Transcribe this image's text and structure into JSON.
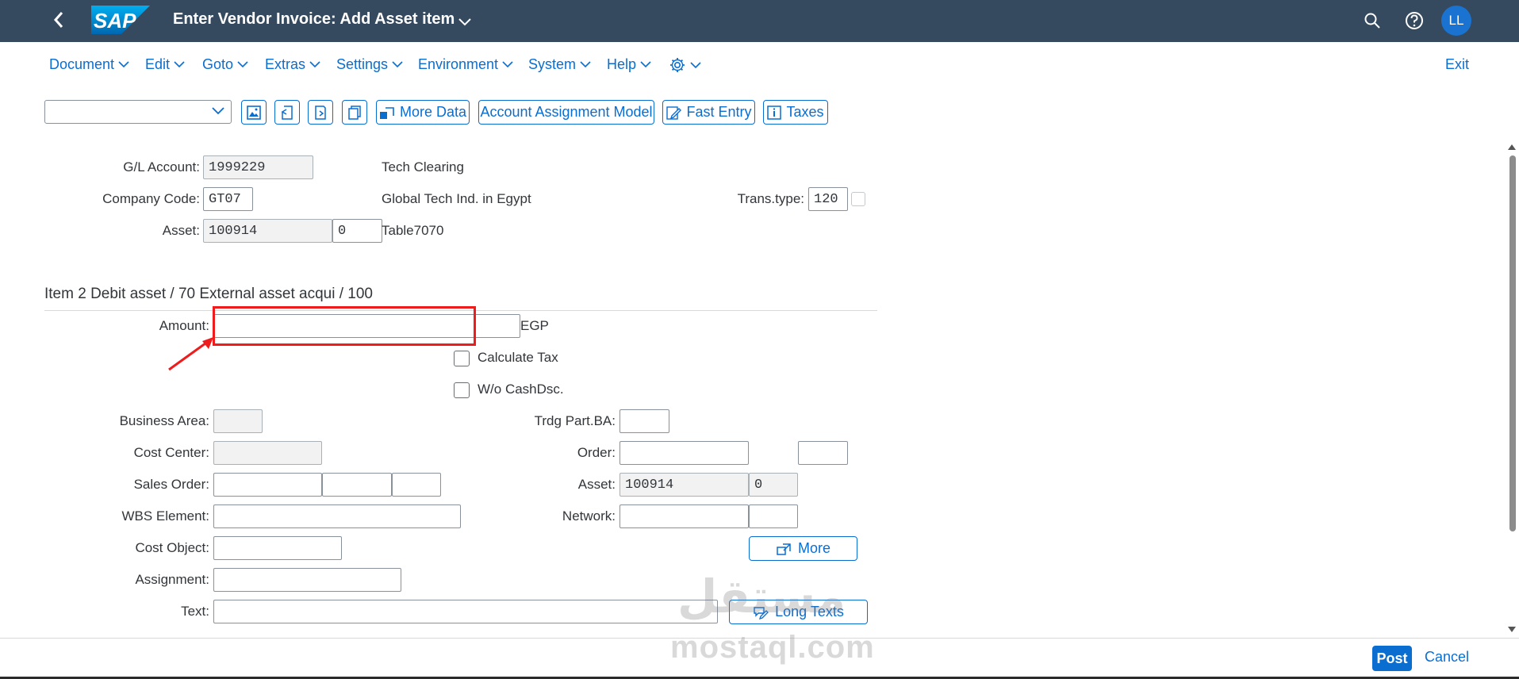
{
  "shell": {
    "title": "Enter Vendor Invoice: Add Asset item",
    "logo_text": "SAP",
    "avatar_initials": "LL"
  },
  "menu": {
    "items": [
      "Document",
      "Edit",
      "Goto",
      "Extras",
      "Settings",
      "Environment",
      "System",
      "Help"
    ],
    "exit_label": "Exit"
  },
  "toolbar": {
    "command_field_value": "",
    "more_data_label": "More Data",
    "account_assignment_label": "Account Assignment Model",
    "fast_entry_label": "Fast Entry",
    "taxes_label": "Taxes"
  },
  "header": {
    "gl_account_label": "G/L Account:",
    "gl_account_value": "1999229",
    "gl_account_text": "Tech Clearing",
    "company_code_label": "Company Code:",
    "company_code_value": "GT07",
    "company_text": "Global Tech Ind. in Egypt",
    "trans_type_label": "Trans.type:",
    "trans_type_value": "120",
    "asset_label": "Asset:",
    "asset_value": "100914",
    "asset_sub": "0",
    "asset_text": "Table7070"
  },
  "item": {
    "section_title": "Item 2 Debit asset / 70 External asset acqui / 100",
    "amount_label": "Amount:",
    "amount_value": "",
    "currency": "EGP",
    "calculate_tax_label": "Calculate Tax",
    "wo_cashdsc_label": "W/o CashDsc.",
    "business_area_label": "Business Area:",
    "trdg_part_label": "Trdg Part.BA:",
    "cost_center_label": "Cost Center:",
    "order_label": "Order:",
    "sales_order_label": "Sales Order:",
    "asset_label": "Asset:",
    "asset_value": "100914",
    "asset_sub": "0",
    "wbs_label": "WBS Element:",
    "network_label": "Network:",
    "cost_object_label": "Cost Object:",
    "more_label": "More",
    "assignment_label": "Assignment:",
    "text_label": "Text:",
    "long_texts_label": "Long Texts"
  },
  "footer": {
    "post_label": "Post",
    "cancel_label": "Cancel"
  },
  "watermark": {
    "arabic": "مستقل",
    "latin": "mostaql.com"
  },
  "colors": {
    "shell": "#354a5f",
    "accent": "#0a6ed1",
    "highlight": "#ee1c1c"
  }
}
